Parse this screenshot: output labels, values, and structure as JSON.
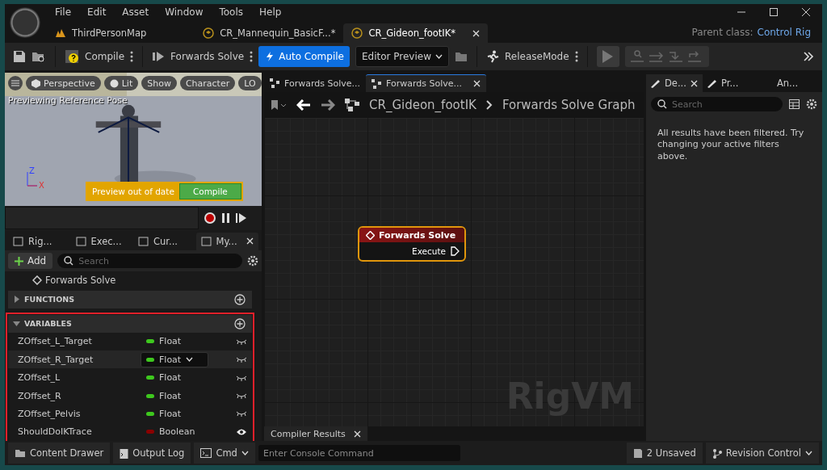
{
  "menu": [
    "File",
    "Edit",
    "Asset",
    "Window",
    "Tools",
    "Help"
  ],
  "doc_tabs": [
    {
      "label": "ThirdPersonMap",
      "kind": "map",
      "selected": false
    },
    {
      "label": "CR_Mannequin_BasicF...*",
      "kind": "rig",
      "selected": false
    },
    {
      "label": "CR_Gideon_footIK*",
      "kind": "rig",
      "selected": true
    }
  ],
  "parent_class": {
    "label": "Parent class:",
    "value": "Control Rig"
  },
  "toolbar": {
    "compile": "Compile",
    "forwards_solve": "Forwards Solve",
    "auto_compile": {
      "label": "Auto Compile",
      "on": true
    },
    "preview_mode": "Editor Preview",
    "release_mode": "ReleaseMode"
  },
  "viewport": {
    "buttons": [
      "Perspective",
      "Lit",
      "Show",
      "Character",
      "LO"
    ],
    "status": "Previewing Reference Pose",
    "axis_z": "Z",
    "axis_x": "X",
    "warning": "Preview out of date",
    "compile": "Compile"
  },
  "left_tabs": [
    {
      "label": "Rig...",
      "selected": false
    },
    {
      "label": "Exec...",
      "selected": false
    },
    {
      "label": "Cur...",
      "selected": false
    },
    {
      "label": "My...",
      "selected": true
    }
  ],
  "my_blueprint": {
    "add": "Add",
    "search_placeholder": "Search",
    "graph_item": "Forwards Solve",
    "sections": [
      {
        "title": "FUNCTIONS",
        "expanded": false
      },
      {
        "title": "VARIABLES",
        "expanded": true
      }
    ],
    "variables": [
      {
        "name": "ZOffset_L_Target",
        "type": "Float",
        "color": "#3ec81e",
        "public": false,
        "hovered": false
      },
      {
        "name": "ZOffset_R_Target",
        "type": "Float",
        "color": "#3ec81e",
        "public": false,
        "hovered": true
      },
      {
        "name": "ZOffset_L",
        "type": "Float",
        "color": "#3ec81e",
        "public": false,
        "hovered": false
      },
      {
        "name": "ZOffset_R",
        "type": "Float",
        "color": "#3ec81e",
        "public": false,
        "hovered": false
      },
      {
        "name": "ZOffset_Pelvis",
        "type": "Float",
        "color": "#3ec81e",
        "public": false,
        "hovered": false
      },
      {
        "name": "ShouldDoIKTrace",
        "type": "Boolean",
        "color": "#8b0000",
        "public": true,
        "hovered": false
      }
    ]
  },
  "graph_tabs": [
    {
      "label": "Forwards Solve...",
      "selected": false
    },
    {
      "label": "Forwards Solve...",
      "selected": true
    }
  ],
  "breadcrumb": [
    "CR_Gideon_footIK",
    "Forwards Solve Graph"
  ],
  "node": {
    "title": "Forwards Solve",
    "pin": "Execute"
  },
  "graph_label": "RigVM",
  "details_tabs": [
    {
      "label": "De...",
      "selected": true
    },
    {
      "label": "Pr...",
      "selected": false
    },
    {
      "label": "An...",
      "selected": false
    }
  ],
  "details": {
    "search_placeholder": "Search",
    "message": "All results have been filtered. Try changing your active filters above."
  },
  "bottom_tab": "Compiler Results",
  "status_bar": {
    "content_drawer": "Content Drawer",
    "output_log": "Output Log",
    "cmd": "Cmd",
    "console_placeholder": "Enter Console Command",
    "unsaved": "2 Unsaved",
    "revision_control": "Revision Control"
  }
}
